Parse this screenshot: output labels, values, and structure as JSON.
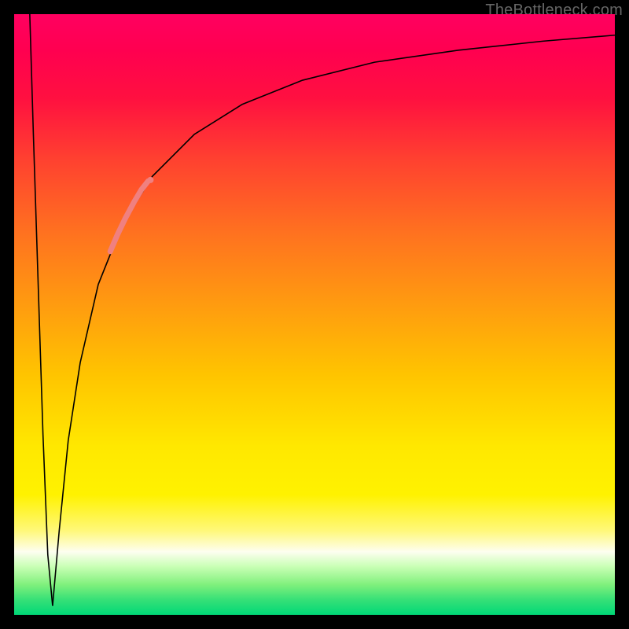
{
  "watermark": "TheBottleneck.com",
  "chart_data": {
    "type": "line",
    "title": "",
    "xlabel": "",
    "ylabel": "",
    "xlim": [
      0,
      100
    ],
    "ylim": [
      0,
      100
    ],
    "background_gradient_axis": "y",
    "background_gradient": [
      {
        "stop": 0,
        "color": "#ff0060"
      },
      {
        "stop": 0.36,
        "color": "#ff7020"
      },
      {
        "stop": 0.72,
        "color": "#ffe800"
      },
      {
        "stop": 0.895,
        "color": "#fdfef0"
      },
      {
        "stop": 1.0,
        "color": "#00d877"
      }
    ],
    "series": [
      {
        "name": "descending-branch",
        "color": "#000000",
        "width": 1.6,
        "x": [
          2.6,
          3.2,
          4.0,
          4.8,
          5.6,
          6.4
        ],
        "y": [
          100,
          80,
          55,
          30,
          10,
          1.5
        ]
      },
      {
        "name": "ascending-curve",
        "color": "#000000",
        "width": 1.6,
        "x": [
          6.4,
          7.5,
          9,
          11,
          14,
          18,
          23,
          30,
          38,
          48,
          60,
          74,
          88,
          100
        ],
        "y": [
          1.5,
          14,
          29,
          42,
          55,
          65,
          73,
          80,
          85,
          89,
          92,
          94,
          95.5,
          96.5
        ]
      },
      {
        "name": "highlight-segment",
        "color": "#f08080",
        "width": 7,
        "linecap": "round",
        "x": [
          16,
          17.2,
          18.5,
          20,
          21.2,
          22.3
        ],
        "y": [
          60.5,
          63.3,
          66,
          68.8,
          70.8,
          72.2
        ]
      },
      {
        "name": "highlight-end-dot",
        "color": "#f08080",
        "marker": "circle",
        "radius": 4,
        "x": [
          22.7
        ],
        "y": [
          72.4
        ]
      }
    ]
  }
}
